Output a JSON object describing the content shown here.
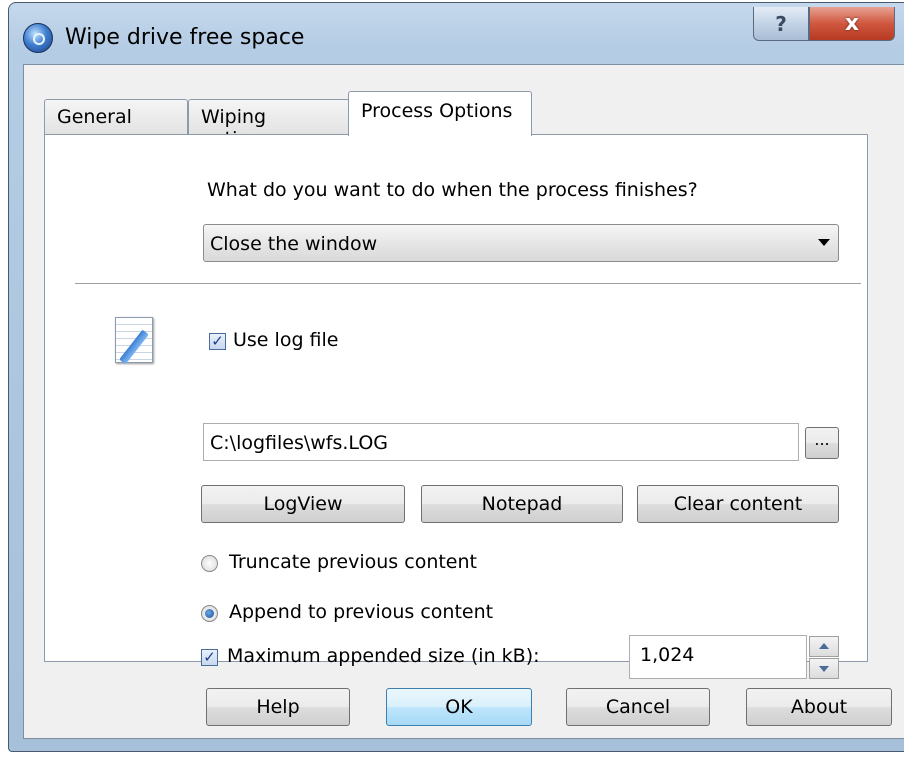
{
  "window": {
    "title": "Wipe drive free space",
    "help_caption": "?",
    "close_caption": "x"
  },
  "tabs": [
    {
      "label": "General",
      "active": false
    },
    {
      "label": "Wiping options",
      "active": false
    },
    {
      "label": "Process Options",
      "active": true
    }
  ],
  "process": {
    "question": "What do you want to do when the process finishes?",
    "finish_action": "Close the window"
  },
  "log": {
    "use_log_label": "Use log file",
    "use_log_checked": true,
    "path": "C:\\logfiles\\wfs.LOG",
    "browse_label": "...",
    "buttons": [
      "LogView",
      "Notepad",
      "Clear content"
    ],
    "truncate_label": "Truncate previous content",
    "truncate_checked": false,
    "append_label": "Append to previous content",
    "append_checked": true,
    "max_size_label": "Maximum appended size (in kB):",
    "max_size_checked": true,
    "max_size_value": "1,024"
  },
  "footer": {
    "help": "Help",
    "ok": "OK",
    "cancel": "Cancel",
    "about": "About"
  },
  "check_mark": "✓"
}
